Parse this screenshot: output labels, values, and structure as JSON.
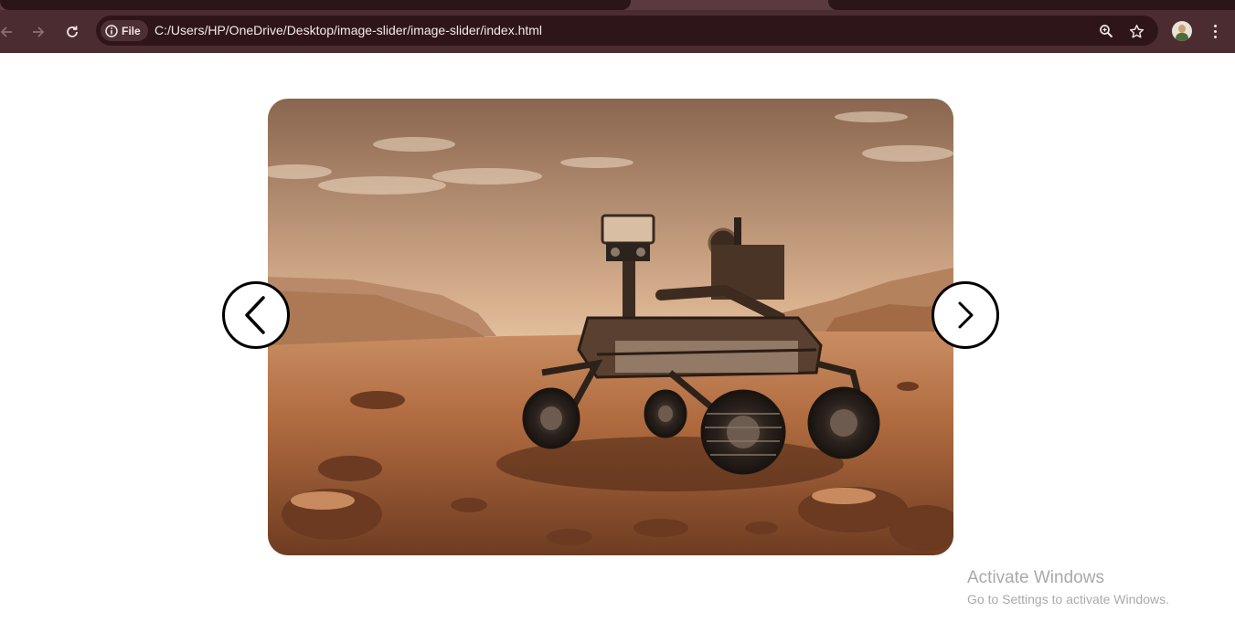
{
  "browser": {
    "security_chip_label": "File",
    "url": "C:/Users/HP/OneDrive/Desktop/image-slider/image-slider/index.html",
    "icons": [
      "back-icon",
      "forward-icon",
      "reload-icon",
      "info-icon",
      "zoom-icon",
      "bookmark-star-icon",
      "profile-avatar",
      "more-menu-icon"
    ]
  },
  "slider": {
    "image_subject": "Mars rover on rocky desert terrain",
    "prev_icon": "chevron-left-icon",
    "next_icon": "chevron-right-icon"
  },
  "watermark": {
    "title": "Activate Windows",
    "subtitle": "Go to Settings to activate Windows."
  },
  "colors": {
    "toolbar": "#4a2c31",
    "omnibox": "#2e1519",
    "page_background": "#ffffff"
  }
}
